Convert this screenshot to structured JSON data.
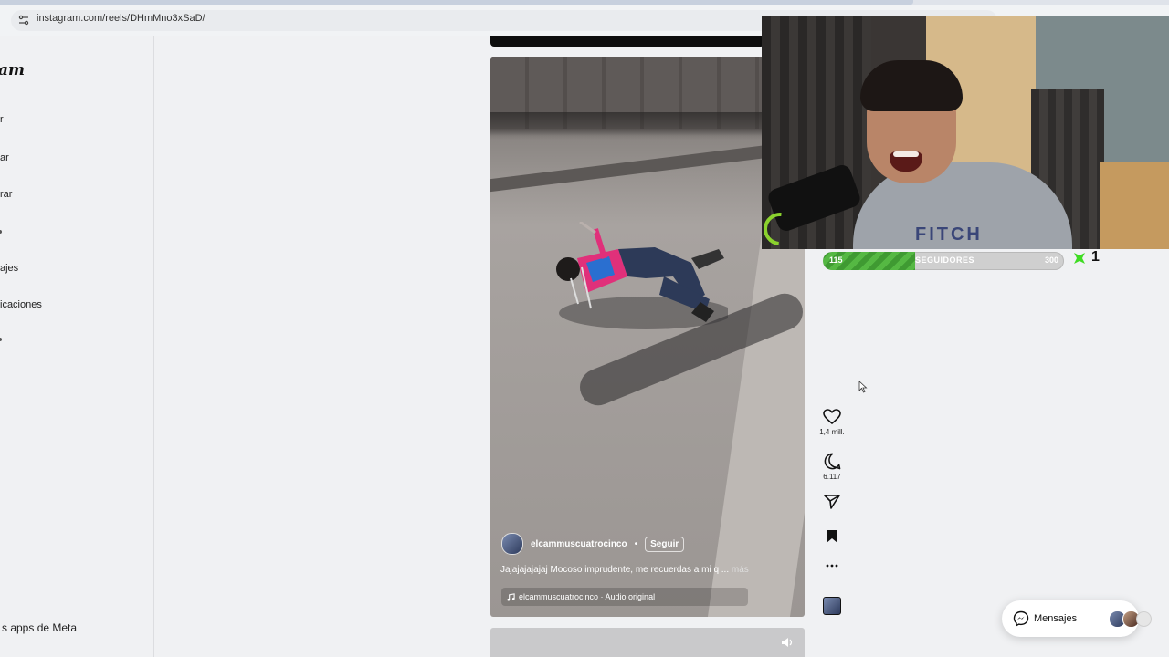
{
  "browser": {
    "url": "instagram.com/reels/DHmMno3xSaD/"
  },
  "sidebar": {
    "logo_partial": "am",
    "items": [
      {
        "label": "r"
      },
      {
        "label": "rar"
      },
      {
        "label": "ajes"
      },
      {
        "label": "icaciones"
      }
    ],
    "footer": "s apps de Meta"
  },
  "reel": {
    "author": "elcammuscuatrocinco",
    "separator": "•",
    "follow_label": "Seguir",
    "caption": "Jajajajajajaj Mocoso imprudente, me recuerdas a mi q ...",
    "caption_more": "más",
    "audio": "elcammuscuatrocinco · Audio original"
  },
  "actions": {
    "likes": "1,4 mill.",
    "comments": "6.117"
  },
  "overlay": {
    "goal_current": "115",
    "goal_label": "SEGUIDORES",
    "goal_target": "300",
    "goal_progress": 0.383,
    "streak_count": "1",
    "shirt_text": "FITCH",
    "accent": "#55b843"
  },
  "messages": {
    "label": "Mensajes"
  }
}
